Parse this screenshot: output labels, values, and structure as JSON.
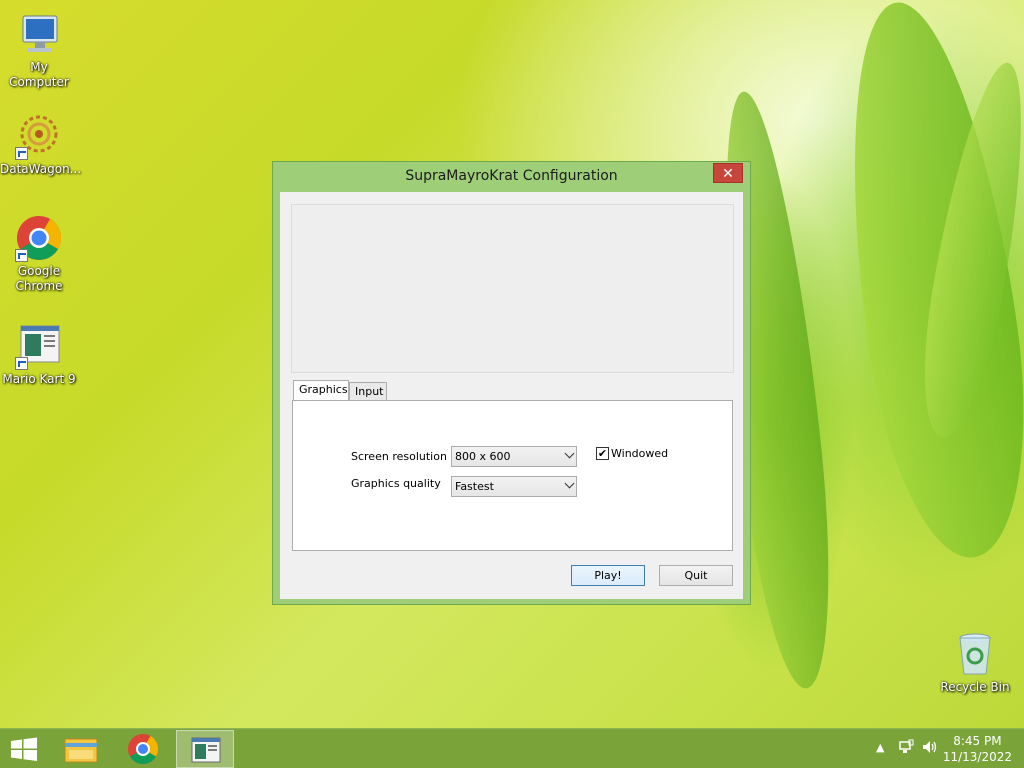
{
  "desktop": {
    "icons": [
      {
        "label": "My Computer"
      },
      {
        "label": "DataWagon..."
      },
      {
        "label": "Google Chrome"
      },
      {
        "label": "Mario Kart 9"
      },
      {
        "label": "Recycle Bin"
      }
    ]
  },
  "dialog": {
    "title": "SupraMayroKrat Configuration",
    "close_glyph": "✕",
    "tabs": [
      {
        "label": "Graphics",
        "selected": true
      },
      {
        "label": "Input",
        "selected": false
      }
    ],
    "screen_resolution": {
      "label": "Screen resolution",
      "value": "800 x 600"
    },
    "graphics_quality": {
      "label": "Graphics quality",
      "value": "Fastest"
    },
    "windowed": {
      "label": "Windowed",
      "checked": true,
      "check_glyph": "✔"
    },
    "play_label": "Play!",
    "quit_label": "Quit"
  },
  "taskbar": {
    "pinned": [
      "start-icon",
      "file-explorer-icon",
      "chrome-icon",
      "mario-kart-app-icon"
    ],
    "tray": {
      "chevron": "▲"
    },
    "clock": {
      "time": "8:45 PM",
      "date": "11/13/2022"
    }
  },
  "colors": {
    "titlebar": "#9fce78",
    "close_button": "#c7463c",
    "taskbar": "#7aa33a"
  }
}
